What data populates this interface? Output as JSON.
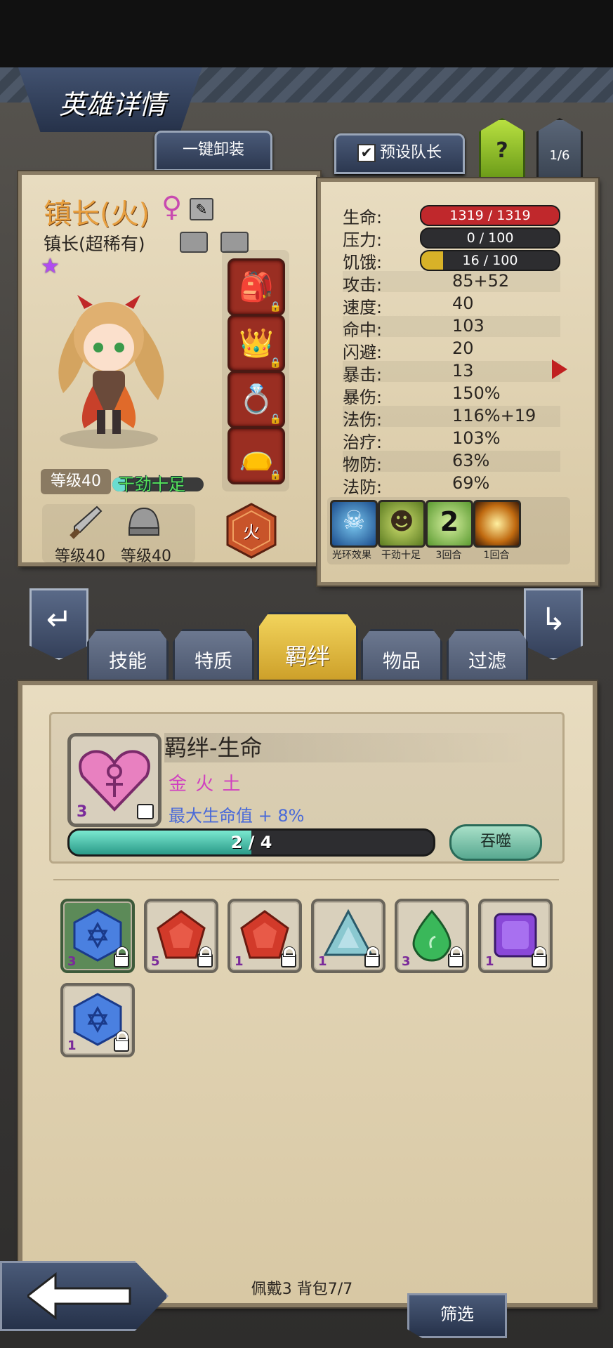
{
  "header": {
    "title": "英雄详情"
  },
  "top_buttons": {
    "unequip_all": "一键卸装",
    "preset_captain": "预设队长",
    "help": "?",
    "page": "1/6"
  },
  "hero": {
    "name": "镇长(火)",
    "class_rarity": "镇长(超稀有)",
    "level_label": "等级40",
    "status": "干劲十足",
    "element": "火",
    "weapon_level": "等级40",
    "armor_level": "等级40",
    "gender_symbol": "♀"
  },
  "stats": {
    "hp_label": "生命:",
    "hp_value": "1319 / 1319",
    "hp_fraction": 1.0,
    "stress_label": "压力:",
    "stress_value": "0 / 100",
    "stress_fraction": 0.0,
    "hunger_label": "饥饿:",
    "hunger_value": "16 / 100",
    "hunger_fraction": 0.16,
    "rows": [
      {
        "label": "攻击:",
        "value": "85+52"
      },
      {
        "label": "速度:",
        "value": "40"
      },
      {
        "label": "命中:",
        "value": "103"
      },
      {
        "label": "闪避:",
        "value": "20"
      },
      {
        "label": "暴击:",
        "value": "13"
      },
      {
        "label": "暴伤:",
        "value": "150%"
      },
      {
        "label": "法伤:",
        "value": "116%+19"
      },
      {
        "label": "治疗:",
        "value": "103%"
      },
      {
        "label": "物防:",
        "value": "63%"
      },
      {
        "label": "法防:",
        "value": "69%"
      }
    ]
  },
  "buffs": [
    {
      "caption": "光环效果",
      "icon": "skull-aura-icon"
    },
    {
      "caption": "干劲十足",
      "icon": "smiley-blob-icon"
    },
    {
      "caption": "3回合",
      "icon": "number-buff-icon",
      "number": "2"
    },
    {
      "caption": "1回合",
      "icon": "light-burst-icon"
    }
  ],
  "tabs": [
    "技能",
    "特质",
    "羁绊",
    "物品",
    "过滤"
  ],
  "active_tab": "羁绊",
  "bond": {
    "title": "羁绊-生命",
    "elements": "金 火 土",
    "effect": "最大生命值 + 8%",
    "progress_text": "2 / 4",
    "progress_fraction": 0.5,
    "devour_button": "吞噬",
    "gem_count": "3"
  },
  "gems": [
    {
      "count": "3",
      "color": "blue",
      "shape": "hexagon-star",
      "selected": true
    },
    {
      "count": "5",
      "color": "red",
      "shape": "pentagon"
    },
    {
      "count": "1",
      "color": "red",
      "shape": "pentagon"
    },
    {
      "count": "1",
      "color": "teal",
      "shape": "triangle"
    },
    {
      "count": "3",
      "color": "green",
      "shape": "drop"
    },
    {
      "count": "1",
      "color": "purple",
      "shape": "square"
    },
    {
      "count": "1",
      "color": "blue",
      "shape": "hexagon-star"
    }
  ],
  "footer": {
    "equipped_bag": "佩戴3 背包7/7",
    "filter_button": "筛选"
  },
  "colors": {
    "hp": "#c0282c",
    "hunger": "#d8b228",
    "progress": "#4ab8a0",
    "active_tab": "#e8c040"
  }
}
